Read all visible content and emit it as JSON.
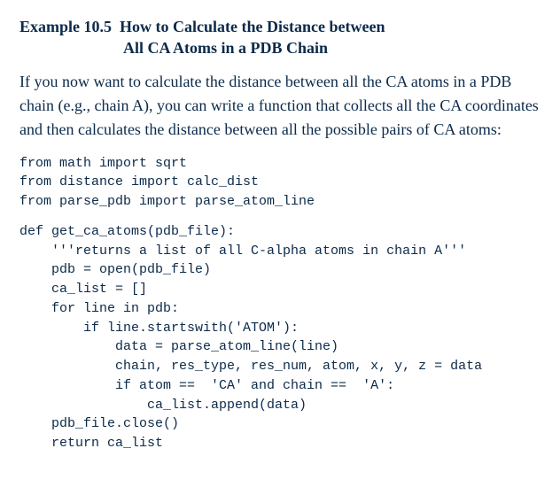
{
  "heading": {
    "label": "Example 10.5",
    "title_line1": "How to Calculate the Distance between",
    "title_line2": "All CA Atoms in a PDB Chain"
  },
  "paragraph": "If you now want to calculate the distance between all the CA atoms in a PDB chain (e.g., chain A), you can write a function that collects all the CA coordinates and then calculates the distance between all the possible pairs of CA atoms:",
  "code": {
    "imports": "from math import sqrt\nfrom distance import calc_dist\nfrom parse_pdb import parse_atom_line",
    "function": "def get_ca_atoms(pdb_file):\n    '''returns a list of all C-alpha atoms in chain A'''\n    pdb = open(pdb_file)\n    ca_list = []\n    for line in pdb:\n        if line.startswith('ATOM'):\n            data = parse_atom_line(line)\n            chain, res_type, res_num, atom, x, y, z = data\n            if atom ==  'CA' and chain ==  'A':\n                ca_list.append(data)\n    pdb_file.close()\n    return ca_list"
  }
}
